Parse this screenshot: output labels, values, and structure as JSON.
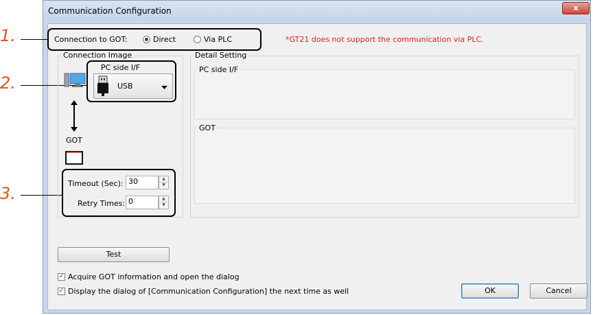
{
  "window": {
    "title": "Communication Configuration",
    "close": "x"
  },
  "callouts": {
    "n1": "1.",
    "n2": "2.",
    "n3": "3."
  },
  "connection": {
    "label": "Connection to GOT:",
    "direct": "Direct",
    "via_plc": "Via PLC",
    "selected": "Direct",
    "note": "*GT21 does not support the communication via PLC."
  },
  "connection_image": {
    "title": "Connection Image",
    "pc_side_label": "PC side I/F",
    "pc_side_value": "USB",
    "got_label": "GOT",
    "timeout_label": "Timeout (Sec):",
    "timeout_value": "30",
    "retry_label": "Retry Times:",
    "retry_value": "0"
  },
  "detail_setting": {
    "title": "Detail Setting",
    "pc_side_title": "PC side I/F",
    "got_title": "GOT"
  },
  "buttons": {
    "test": "Test",
    "ok": "OK",
    "cancel": "Cancel"
  },
  "options": {
    "acquire": "Acquire GOT information and open the dialog",
    "acquire_checked": true,
    "display_next": "Display the dialog of [Communication Configuration] the next time as well",
    "display_next_checked": true
  },
  "icons": [
    "pc-icon",
    "usb-icon",
    "dropdown-arrow-icon",
    "double-arrow-icon",
    "got-screen-icon",
    "close-icon"
  ]
}
